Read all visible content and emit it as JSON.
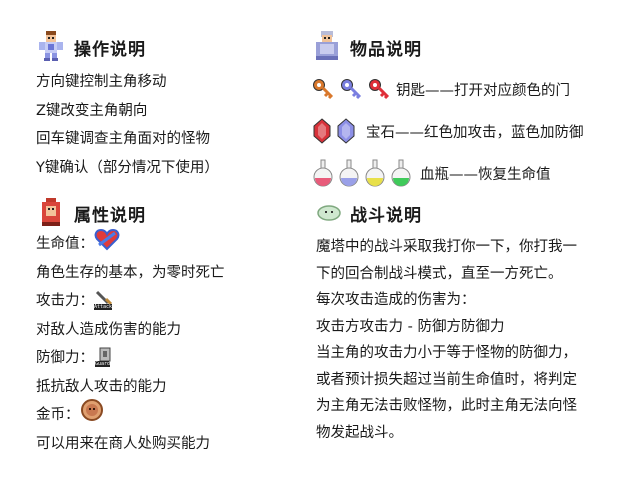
{
  "controls": {
    "title": "操作说明",
    "icon": "hero-knight-icon",
    "lines": [
      "方向键控制主角移动",
      "Z键改变主角朝向",
      "回车键调查主角面对的怪物",
      "Y键确认（部分情况下使用）"
    ]
  },
  "items": {
    "title": "物品说明",
    "icon": "merchant-icon",
    "keys_label": "钥匙——打开对应颜色的门",
    "gems_label": "宝石——红色加攻击，蓝色加防御",
    "potions_label": "血瓶——恢复生命值",
    "key_colors": [
      "#d9782c",
      "#7a7fe0",
      "#e0303a"
    ],
    "gem_colors": [
      "#d8323a",
      "#8c8fe6"
    ],
    "potion_colors": [
      "#e85b7a",
      "#9aa0e8",
      "#e8e04a",
      "#3fca5a"
    ]
  },
  "attributes": {
    "title": "属性说明",
    "icon": "red-bag-icon",
    "hp_label": "生命值：",
    "hp_desc": "角色生存的基本，为零时死亡",
    "atk_label": "攻击力：",
    "atk_icon_text": "Attack",
    "atk_desc": "对敌人造成伤害的能力",
    "def_label": "防御力：",
    "def_icon_text": "Guard",
    "def_desc": "抵抗敌人攻击的能力",
    "gold_label": "金币：",
    "gold_desc": "可以用来在商人处购买能力"
  },
  "battle": {
    "title": "战斗说明",
    "icon": "slime-icon",
    "lines": [
      "魔塔中的战斗采取我打你一下，你打我一",
      "下的回合制战斗模式，直至一方死亡。",
      "每次攻击造成的伤害为：",
      "攻击方攻击力 - 防御方防御力",
      "当主角的攻击力小于等于怪物的防御力，",
      "或者预计损失超过当前生命值时，将判定",
      "为主角无法击败怪物，此时主角无法向怪",
      "物发起战斗。"
    ]
  }
}
